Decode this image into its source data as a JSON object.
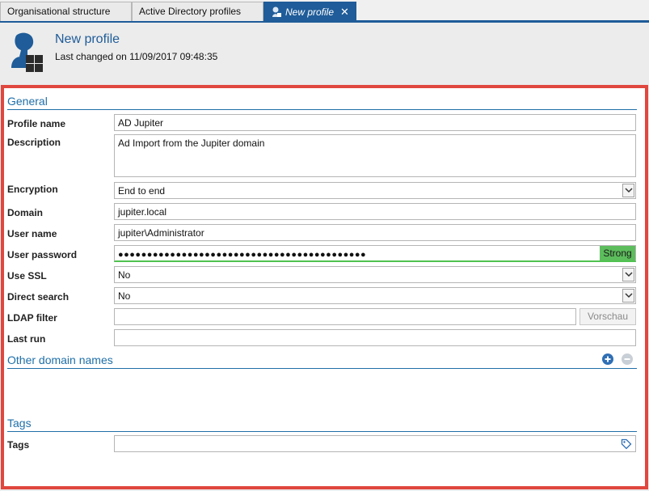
{
  "tabs": [
    {
      "label": "Organisational structure"
    },
    {
      "label": "Active Directory profiles"
    },
    {
      "label": "New profile",
      "close": "✕"
    }
  ],
  "header": {
    "title": "New profile",
    "subtitle": "Last changed on 11/09/2017 09:48:35"
  },
  "general": {
    "heading": "General",
    "profile_name": {
      "label": "Profile name",
      "value": "AD Jupiter"
    },
    "description": {
      "label": "Description",
      "value": "Ad Import from the Jupiter domain"
    },
    "encryption": {
      "label": "Encryption",
      "value": "End to end"
    },
    "domain": {
      "label": "Domain",
      "value": "jupiter.local"
    },
    "user_name": {
      "label": "User name",
      "value": "jupiter\\Administrator"
    },
    "user_password": {
      "label": "User password",
      "value": "●●●●●●●●●●●●●●●●●●●●●●●●●●●●●●●●●●●●●●●●●●●",
      "strength": "Strong"
    },
    "use_ssl": {
      "label": "Use SSL",
      "value": "No"
    },
    "direct_search": {
      "label": "Direct search",
      "value": "No"
    },
    "ldap_filter": {
      "label": "LDAP filter",
      "value": "",
      "button": "Vorschau"
    },
    "last_run": {
      "label": "Last run",
      "value": ""
    }
  },
  "other_domains": {
    "heading": "Other domain names",
    "add_icon": "plus-circle-icon",
    "remove_icon": "minus-circle-icon"
  },
  "tags_section": {
    "heading": "Tags",
    "tags": {
      "label": "Tags",
      "value": ""
    },
    "icon": "tag-icon"
  },
  "colors": {
    "accent": "#1f5c99",
    "section": "#1f6fa8",
    "highlight_border": "#e0473e",
    "strength_green": "#5cbd5c"
  }
}
